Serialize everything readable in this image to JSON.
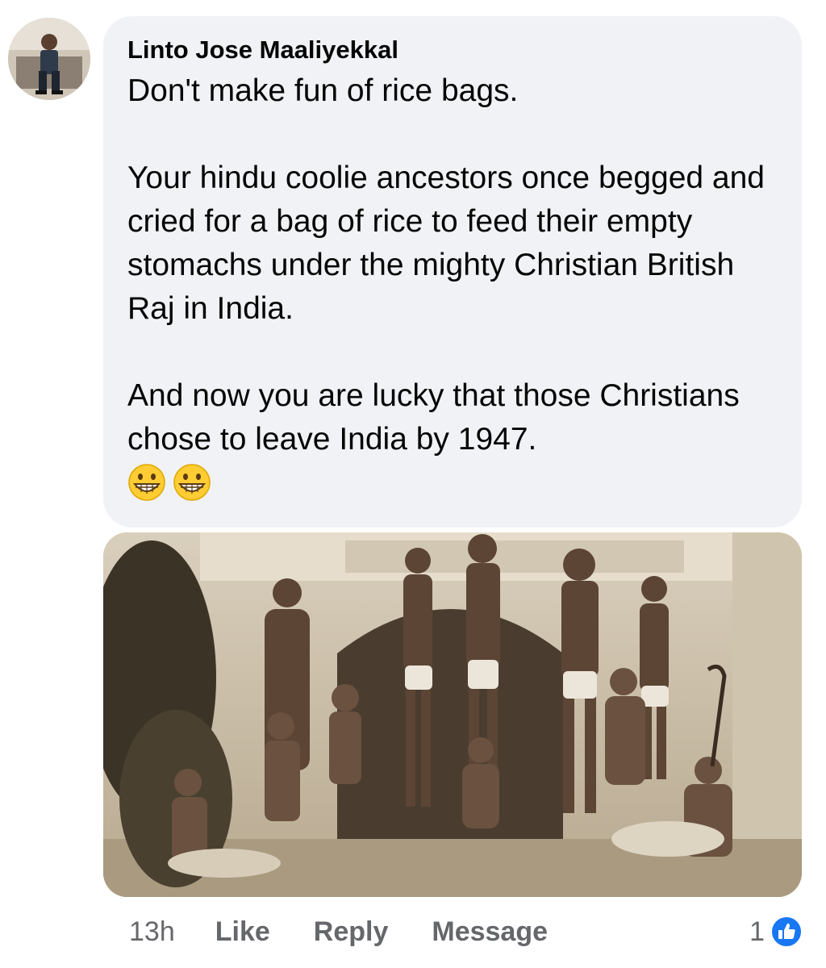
{
  "comment": {
    "author": "Linto Jose Maaliyekkal",
    "paragraphs": [
      "Don't make fun of rice bags.",
      "Your hindu coolie ancestors once begged and cried for a bag of rice to feed their empty stomachs under the mighty Christian British Raj in India.",
      "And now you are lucky that those Christians chose to leave India by 1947."
    ],
    "emojis": [
      "grinning-face-emoji",
      "grinning-face-emoji"
    ]
  },
  "attachment": {
    "icon": "sepia-photograph"
  },
  "actions": {
    "time": "13h",
    "like": "Like",
    "reply": "Reply",
    "message": "Message"
  },
  "reactions": {
    "count": "1",
    "icon": "like-icon",
    "color": "#1877f2"
  },
  "colors": {
    "bubble": "#f0f2f5",
    "muted_text": "#65676b"
  }
}
